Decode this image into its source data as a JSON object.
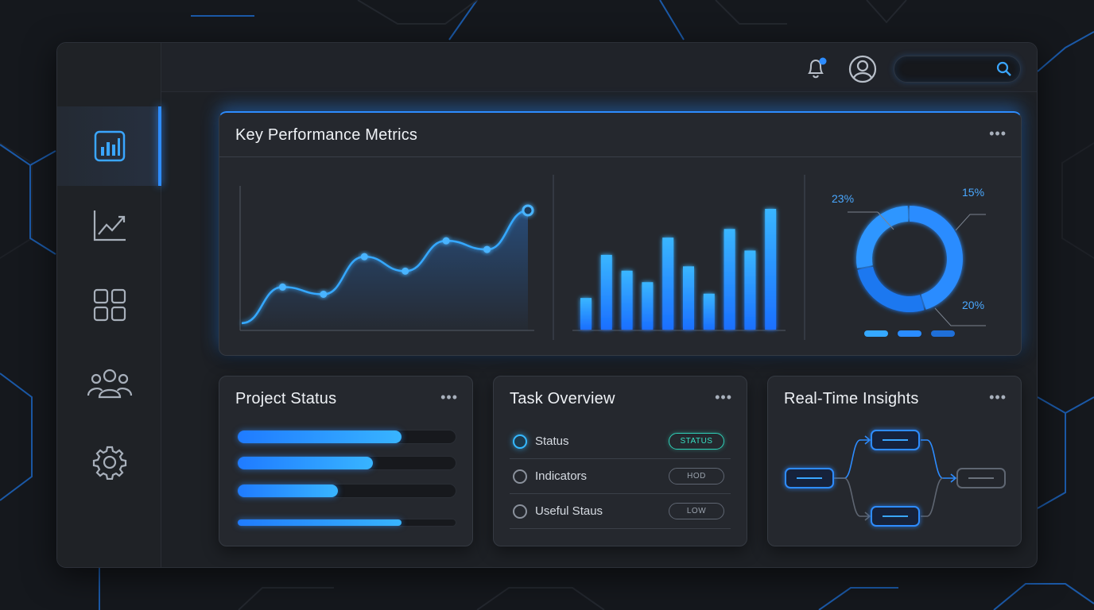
{
  "header": {
    "notification_icon": "bell-icon",
    "avatar_icon": "user-circle-icon",
    "search": {
      "placeholder": "",
      "icon": "search-icon"
    }
  },
  "sidebar": {
    "items": [
      {
        "icon": "bar-chart-icon",
        "active": true
      },
      {
        "icon": "line-chart-icon",
        "active": false
      },
      {
        "icon": "grid-icon",
        "active": false
      },
      {
        "icon": "users-icon",
        "active": false
      },
      {
        "icon": "gear-icon",
        "active": false
      }
    ]
  },
  "kpi": {
    "title": "Key Performance Metrics",
    "menu": "•••"
  },
  "chart_data": [
    {
      "type": "area",
      "x": [
        1,
        2,
        3,
        4,
        5,
        6,
        7,
        8
      ],
      "values": [
        5,
        30,
        25,
        51,
        41,
        62,
        56,
        83
      ],
      "ylim": [
        0,
        100
      ]
    },
    {
      "type": "bar",
      "values": [
        22,
        52,
        41,
        33,
        64,
        44,
        25,
        70,
        55,
        84
      ],
      "ylim": [
        0,
        100
      ]
    },
    {
      "type": "pie",
      "slice_labels": [
        "15%",
        "20%",
        "23%"
      ],
      "legend_swatches": [
        "#35a8ff",
        "#2a8cff",
        "#1f6fd8"
      ]
    }
  ],
  "project_status": {
    "title": "Project Status",
    "menu": "•••",
    "progress": [
      0.75,
      0.62,
      0.46,
      0.75
    ]
  },
  "task_overview": {
    "title": "Task Overview",
    "menu": "•••",
    "rows": [
      {
        "label": "Status",
        "badge": "STATUS",
        "selected": true
      },
      {
        "label": "Indicators",
        "badge": "HOD",
        "selected": false
      },
      {
        "label": "Useful Staus",
        "badge": "LOW",
        "selected": false
      }
    ]
  },
  "insights": {
    "title": "Real-Time Insights",
    "menu": "•••"
  },
  "colors": {
    "accent": "#2d8cff",
    "accent_light": "#38b4ff",
    "teal": "#2fd1b8",
    "card": "#25282e",
    "background": "#15181d"
  }
}
